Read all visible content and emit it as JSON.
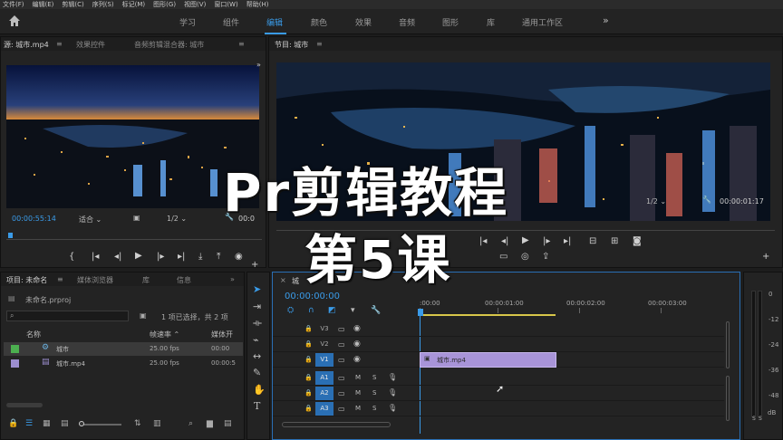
{
  "menu": [
    "文件(F)",
    "编辑(E)",
    "剪辑(C)",
    "序列(S)",
    "标记(M)",
    "图形(G)",
    "视图(V)",
    "窗口(W)",
    "帮助(H)"
  ],
  "workspaces": [
    "学习",
    "组件",
    "编辑",
    "颜色",
    "效果",
    "音频",
    "图形",
    "库",
    "通用工作区"
  ],
  "active_workspace": "编辑",
  "source_panel": {
    "tabs": [
      "源: 城市.mp4",
      "效果控件",
      "音频剪辑混合器: 城市"
    ],
    "timecode": "00:00:55:14",
    "fit": "适合",
    "quality": "1/2",
    "end_timecode": "00:0"
  },
  "program_panel": {
    "tab": "节目: 城市",
    "quality": "1/2",
    "end_timecode": "00:00:01:17"
  },
  "project_panel": {
    "tabs": [
      "项目: 未命名",
      "媒体浏览器",
      "库",
      "信息"
    ],
    "file": "未命名.prproj",
    "selection_info": "1 项已选择，共 2 项",
    "columns": [
      "名称",
      "帧速率",
      "媒体开"
    ],
    "items": [
      {
        "name": "城市",
        "fps": "25.00 fps",
        "start": "00:00",
        "color": "#4caf50",
        "kind": "sequence"
      },
      {
        "name": "城市.mp4",
        "fps": "25.00 fps",
        "start": "00:00:5",
        "color": "#9d8fd0",
        "kind": "clip"
      }
    ]
  },
  "timeline": {
    "tab": "城",
    "timecode": "00:00:00:00",
    "ruler": [
      ":00:00",
      "00:00:01:00",
      "00:00:02:00",
      "00:00:03:00"
    ],
    "tracks": [
      {
        "id": "V3",
        "type": "video"
      },
      {
        "id": "V2",
        "type": "video"
      },
      {
        "id": "V1",
        "type": "video"
      },
      {
        "id": "A1",
        "type": "audio",
        "m": "M",
        "s": "S"
      },
      {
        "id": "A2",
        "type": "audio",
        "m": "M",
        "s": "S"
      },
      {
        "id": "A3",
        "type": "audio",
        "m": "M",
        "s": "S"
      }
    ],
    "clip": "城市.mp4"
  },
  "meter": {
    "labels": [
      "0",
      "-12",
      "-24",
      "-36",
      "-48"
    ],
    "bottom": "dB"
  },
  "overlay": {
    "line1": "Pr剪辑教程",
    "line2": "第5课"
  },
  "colors": {
    "accent": "#3a9be8",
    "clip": "#a894d8",
    "track_active": "#2a6fb4"
  }
}
